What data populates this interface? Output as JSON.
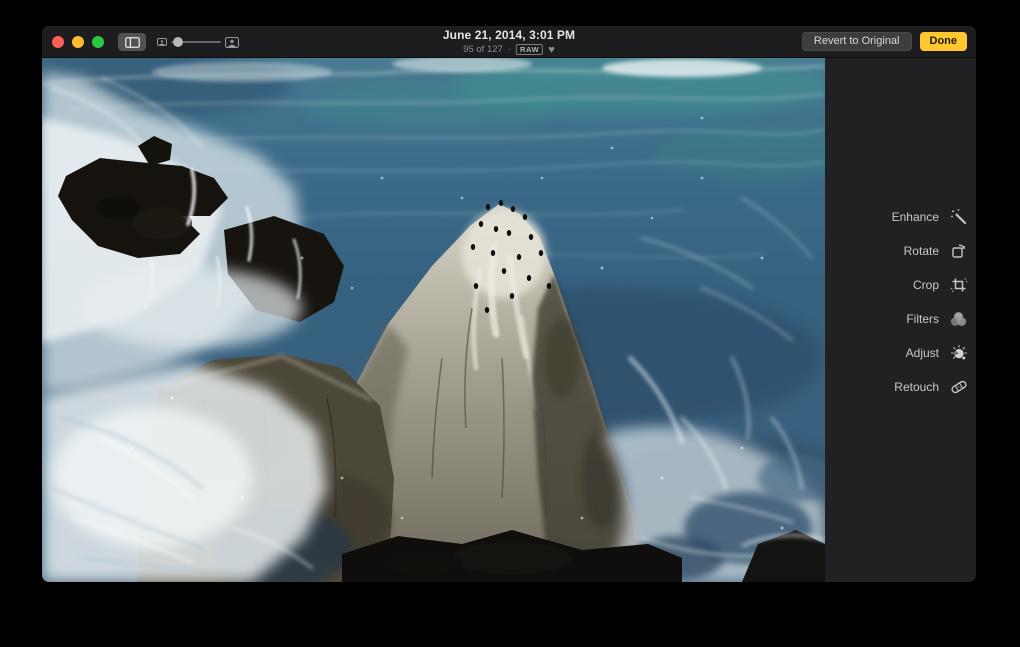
{
  "titlebar": {
    "title": "June 21, 2014, 3:01 PM",
    "counter": "95 of 127",
    "separator": "·",
    "raw_badge": "RAW",
    "revert_button": "Revert to Original",
    "done_button": "Done",
    "icons": {
      "heart": "♥",
      "traffic_lights": [
        "close",
        "minimize",
        "fullscreen"
      ],
      "sidebar_toggle": "sidebar-panel-icon",
      "zoom_small_end": "thumbnail-small-icon",
      "zoom_large_end": "thumbnail-large-icon"
    },
    "zoom_slider": {
      "value_percent": 5
    }
  },
  "sidebar": {
    "tools": [
      {
        "label": "Enhance",
        "icon": "magic-wand-icon"
      },
      {
        "label": "Rotate",
        "icon": "rotate-icon"
      },
      {
        "label": "Crop",
        "icon": "crop-icon"
      },
      {
        "label": "Filters",
        "icon": "filters-circles-icon"
      },
      {
        "label": "Adjust",
        "icon": "adjust-dial-icon"
      },
      {
        "label": "Retouch",
        "icon": "bandage-icon"
      }
    ]
  },
  "photo": {
    "description": "Ocean waves breaking over dark jagged rocks with a tall white sea stack covered in perched cormorants, churning white foam below"
  },
  "colors": {
    "background": "#000000",
    "toolbar_bg": "#1d1d1f",
    "sidebar_bg": "#212123",
    "accent_done_yellow": "#fdc730",
    "revert_button_gray": "#3d3d3f",
    "traffic_red": "#ff5f57",
    "traffic_yellow": "#febc2e",
    "traffic_green": "#28c840",
    "title_text": "#e4e4e5",
    "secondary_text": "#8d8d8f",
    "tool_label_text": "#c9c9ca"
  }
}
